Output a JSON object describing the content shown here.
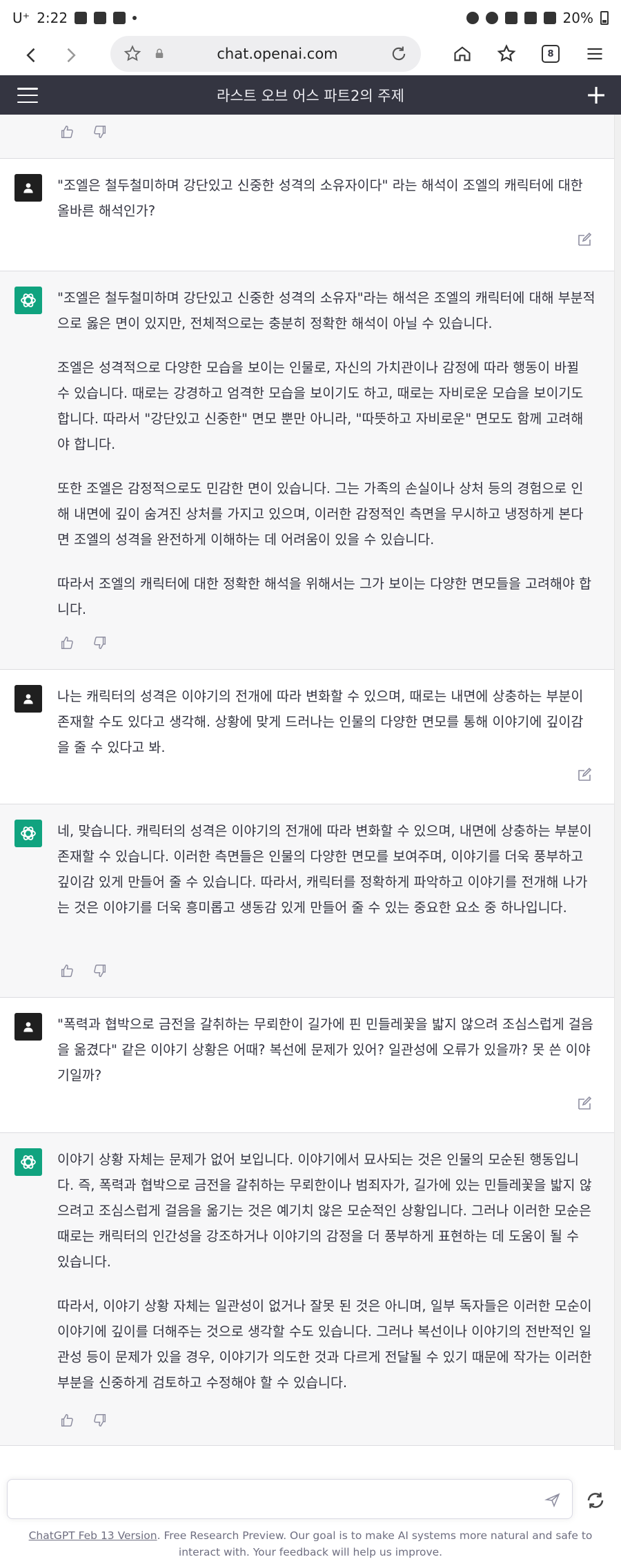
{
  "status_bar": {
    "carrier": "U⁺",
    "time": "2:22",
    "battery": "20%"
  },
  "browser": {
    "url": "chat.openai.com",
    "tab_count": "8"
  },
  "app": {
    "title": "라스트 오브 어스 파트2의 주제"
  },
  "messages": [
    {
      "role": "user",
      "paragraphs": [
        "\"조엘은 철두철미하며 강단있고 신중한 성격의 소유자이다\" 라는 해석이 조엘의 캐릭터에 대한 올바른 해석인가?"
      ]
    },
    {
      "role": "assistant",
      "paragraphs": [
        "\"조엘은 철두철미하며 강단있고 신중한 성격의 소유자\"라는 해석은 조엘의 캐릭터에 대해 부분적으로 옳은 면이 있지만, 전체적으로는 충분히 정확한 해석이 아닐 수 있습니다.",
        "조엘은 성격적으로 다양한 모습을 보이는 인물로, 자신의 가치관이나 감정에 따라 행동이 바뀔 수 있습니다. 때로는 강경하고 엄격한 모습을 보이기도 하고, 때로는 자비로운 모습을 보이기도 합니다. 따라서 \"강단있고 신중한\" 면모 뿐만 아니라, \"따뜻하고 자비로운\" 면모도 함께 고려해야 합니다.",
        "또한 조엘은 감정적으로도 민감한 면이 있습니다. 그는 가족의 손실이나 상처 등의 경험으로 인해 내면에 깊이 숨겨진 상처를 가지고 있으며, 이러한 감정적인 측면을 무시하고 냉정하게 본다면 조엘의 성격을 완전하게 이해하는 데 어려움이 있을 수 있습니다.",
        "따라서 조엘의 캐릭터에 대한 정확한 해석을 위해서는 그가 보이는 다양한 면모들을 고려해야 합니다."
      ]
    },
    {
      "role": "user",
      "paragraphs": [
        "나는 캐릭터의 성격은 이야기의 전개에 따라 변화할 수 있으며, 때로는 내면에 상충하는 부분이 존재할 수도 있다고 생각해. 상황에 맞게 드러나는 인물의 다양한 면모를 통해 이야기에 깊이감을 줄 수 있다고 봐."
      ]
    },
    {
      "role": "assistant",
      "paragraphs": [
        "네, 맞습니다. 캐릭터의 성격은 이야기의 전개에 따라 변화할 수 있으며, 내면에 상충하는 부분이 존재할 수 있습니다. 이러한 측면들은 인물의 다양한 면모를 보여주며, 이야기를 더욱 풍부하고 깊이감 있게 만들어 줄 수 있습니다. 따라서, 캐릭터를 정확하게 파악하고 이야기를 전개해 나가는 것은 이야기를 더욱 흥미롭고 생동감 있게 만들어 줄 수 있는 중요한 요소 중 하나입니다."
      ]
    },
    {
      "role": "user",
      "paragraphs": [
        "\"폭력과 협박으로 금전을 갈취하는 무뢰한이 길가에 핀 민들레꽃을 밟지 않으려 조심스럽게 걸음을 옮겼다\" 같은 이야기 상황은 어때? 복선에 문제가 있어? 일관성에 오류가 있을까? 못 쓴 이야기일까?"
      ]
    },
    {
      "role": "assistant",
      "paragraphs": [
        "이야기 상황 자체는 문제가 없어 보입니다. 이야기에서 묘사되는 것은 인물의 모순된 행동입니다. 즉, 폭력과 협박으로 금전을 갈취하는 무뢰한이나 범죄자가, 길가에 있는 민들레꽃을 밟지 않으려고 조심스럽게 걸음을 옮기는 것은 예기치 않은 모순적인 상황입니다. 그러나 이러한 모순은 때로는 캐릭터의 인간성을 강조하거나 이야기의 감정을 더 풍부하게 표현하는 데 도움이 될 수 있습니다.",
        "따라서, 이야기 상황 자체는 일관성이 없거나 잘못 된 것은 아니며, 일부 독자들은 이러한 모순이 이야기에 깊이를 더해주는 것으로 생각할 수도 있습니다. 그러나 복선이나 이야기의 전반적인 일관성 등이 문제가 있을 경우, 이야기가 의도한 것과 다르게 전달될 수 있기 때문에 작가는 이러한 부분을 신중하게 검토하고 수정해야 할 수 있습니다."
      ]
    }
  ],
  "composer": {
    "placeholder": ""
  },
  "footer": {
    "version_link": "ChatGPT Feb 13 Version",
    "note": ". Free Research Preview. Our goal is to make AI systems more natural and safe to interact with. Your feedback will help us improve."
  },
  "colors": {
    "header_bg": "#343541",
    "assistant_bg": "#f7f7f8",
    "gpt_avatar": "#10a37f",
    "user_avatar": "#1f1f1f"
  }
}
